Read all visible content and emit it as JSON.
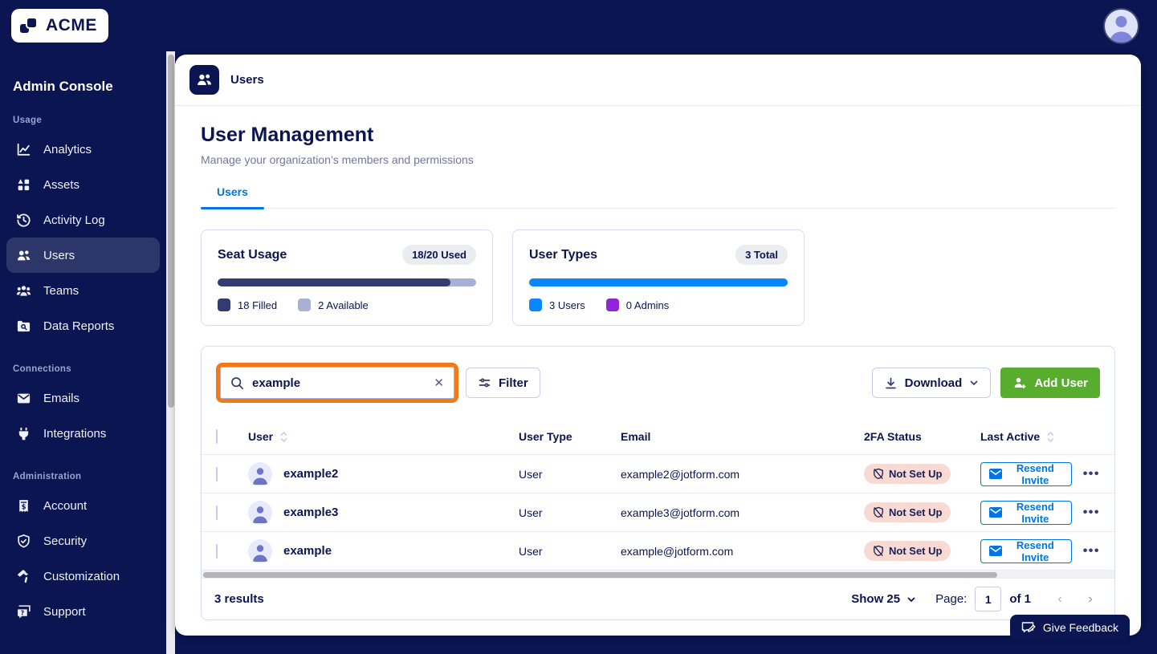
{
  "brand": {
    "logo_text": "ACME"
  },
  "sidebar": {
    "title": "Admin Console",
    "sections": [
      {
        "label": "Usage",
        "items": [
          {
            "label": "Analytics",
            "icon": "analytics-icon",
            "active": false
          },
          {
            "label": "Assets",
            "icon": "assets-icon",
            "active": false
          },
          {
            "label": "Activity Log",
            "icon": "activity-log-icon",
            "active": false
          },
          {
            "label": "Users",
            "icon": "users-icon",
            "active": true
          },
          {
            "label": "Teams",
            "icon": "teams-icon",
            "active": false
          },
          {
            "label": "Data Reports",
            "icon": "data-reports-icon",
            "active": false
          }
        ]
      },
      {
        "label": "Connections",
        "items": [
          {
            "label": "Emails",
            "icon": "email-icon",
            "active": false
          },
          {
            "label": "Integrations",
            "icon": "plug-icon",
            "active": false
          }
        ]
      },
      {
        "label": "Administration",
        "items": [
          {
            "label": "Account",
            "icon": "invoice-icon",
            "active": false
          },
          {
            "label": "Security",
            "icon": "shield-check-icon",
            "active": false
          },
          {
            "label": "Customization",
            "icon": "paint-roller-icon",
            "active": false
          },
          {
            "label": "Support",
            "icon": "support-chat-icon",
            "active": false
          }
        ]
      }
    ]
  },
  "header": {
    "breadcrumb": "Users"
  },
  "page": {
    "title": "User Management",
    "subtitle": "Manage your organization’s members and permissions"
  },
  "tabs": [
    {
      "label": "Users",
      "active": true
    }
  ],
  "cards": {
    "seat_usage": {
      "title": "Seat Usage",
      "badge": "18/20 Used",
      "fill": "90%",
      "legend": [
        {
          "label": "18 Filled",
          "color": "#343b70"
        },
        {
          "label": "2 Available",
          "color": "#a9b0d6"
        }
      ]
    },
    "user_types": {
      "title": "User Types",
      "badge": "3 Total",
      "fill": "100%",
      "legend": [
        {
          "label": "3 Users",
          "color": "#0a86ff"
        },
        {
          "label": "0 Admins",
          "color": "#8f25d8"
        }
      ]
    }
  },
  "toolbar": {
    "search_value": "example",
    "filter_label": "Filter",
    "download_label": "Download",
    "add_user_label": "Add User"
  },
  "table": {
    "columns": {
      "user": "User",
      "type": "User Type",
      "email": "Email",
      "tfa": "2FA Status",
      "last_active": "Last Active"
    },
    "rows": [
      {
        "name": "example2",
        "type": "User",
        "email": "example2@jotform.com",
        "tfa": "Not Set Up",
        "action": "Resend Invite"
      },
      {
        "name": "example3",
        "type": "User",
        "email": "example3@jotform.com",
        "tfa": "Not Set Up",
        "action": "Resend Invite"
      },
      {
        "name": "example",
        "type": "User",
        "email": "example@jotform.com",
        "tfa": "Not Set Up",
        "action": "Resend Invite"
      }
    ]
  },
  "footer": {
    "results": "3 results",
    "show_label": "Show 25",
    "page_label": "Page:",
    "page_value": "1",
    "of_label": "of 1"
  },
  "feedback": {
    "label": "Give Feedback"
  },
  "colors": {
    "navy": "#0a1551",
    "accent_blue": "#0075e3",
    "bar_blue": "#0a86ff",
    "admins_purple": "#8f25d8",
    "add_user_green": "#58ad2f",
    "seat_filled": "#343b70",
    "seat_available": "#a9b0d6",
    "tfa_badge_pink": "#f9d9d4",
    "annotation_orange": "#ef7a17"
  },
  "icons": {
    "search-icon": "magnifier",
    "clear-icon": "x",
    "filter-icon": "filter-lines",
    "download-icon": "arrow-down-tray",
    "chevron-down-icon": "chevron-down",
    "add-user-icon": "person-plus",
    "sort-icon": "up-down-chevrons",
    "shield-off-icon": "shield-slash",
    "mail-icon": "envelope",
    "ellipsis-icon": "three-dots",
    "feedback-icon": "chat-pencil",
    "avatar-icon": "person"
  }
}
